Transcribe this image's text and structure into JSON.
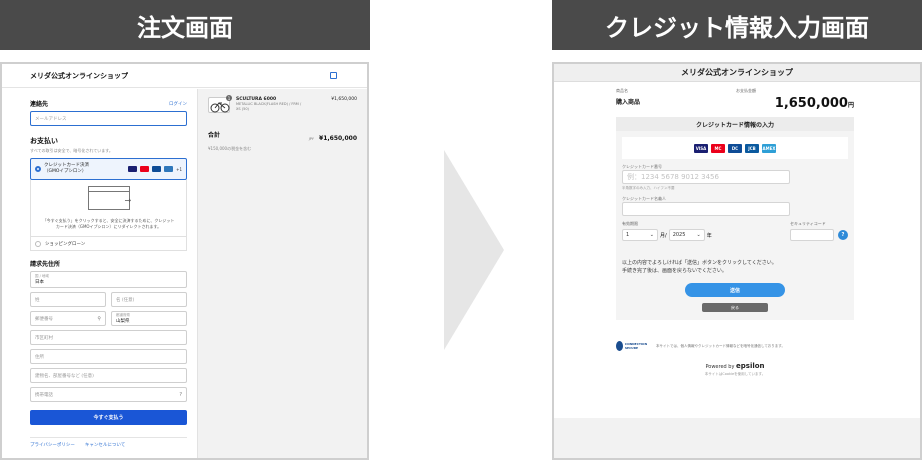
{
  "banners": {
    "left": "注文画面",
    "right": "クレジット情報入力画面"
  },
  "order": {
    "store_title": "メリダ公式オンラインショップ",
    "contact": {
      "heading": "連絡先",
      "login_link": "ログイン",
      "email_placeholder": "メールアドレス"
    },
    "payment": {
      "heading": "お支払い",
      "note": "すべての取引は安全で、暗号化されています。",
      "method_label": "クレジットカード決済（GMOイプシロン）",
      "more_cards": "+1",
      "redirect_text": "「今すぐ支払う」をクリックすると、安全に決済するために、クレジットカード決済（GMOイプシロン）にリダイレクトされます。",
      "loan_label": "ショッピングローン"
    },
    "shipping": {
      "heading": "請求先住所",
      "country_label": "国 / 地域",
      "country_value": "日本",
      "last_name": "姓",
      "first_name": "名 (任意)",
      "postal": "郵便番号",
      "prefecture_label": "都道府県",
      "prefecture_value": "山梨県",
      "city": "市区町村",
      "address": "住所",
      "building": "建物名、部屋番号など (任意)",
      "phone": "携帯電話"
    },
    "pay_button": "今すぐ支払う",
    "footer_links": [
      "プライバシーポリシー",
      "キャンセルについて"
    ],
    "summary": {
      "badge": "1",
      "product_name": "SCULTURA 6000",
      "product_detail": "METALLIC BLACK(FLASH RED) / FRM / XS (50)",
      "product_price": "¥1,650,000",
      "total_label": "合計",
      "total_currency": "JPY",
      "total_value": "¥1,650,000",
      "tax_note": "¥150,000の税金を含む"
    }
  },
  "credit": {
    "store_title": "メリダ公式オンラインショップ",
    "item_label": "商品名",
    "item_value": "購入商品",
    "amount_label": "お支払金額",
    "amount_value": "1,650,000",
    "amount_unit": "円",
    "section_title": "クレジットカード情報の入力",
    "brands": [
      "VISA",
      "MC",
      "DC",
      "JCB",
      "AMEX"
    ],
    "card_number_label": "クレジットカード番号",
    "card_number_placeholder": "例：1234 5678 9012 3456",
    "card_number_help": "半角数字のみ入力、ハイフン不要",
    "holder_label": "クレジットカード名義人",
    "expiry_label": "有効期限",
    "expiry_month": "1",
    "month_unit": "月/",
    "expiry_year": "2025",
    "year_unit": "年",
    "security_label": "セキュリティコード",
    "help_symbol": "?",
    "note_line1": "以上の内容でよろしければ「送信」ボタンをクリックしてください。",
    "note_line2": "手続き完了後は、画面を戻らないでください。",
    "send_button": "送信",
    "back_button": "戻る",
    "security_badge": "CONNECTION SECURE",
    "security_text": "本サイトでは、個人情報やクレジットカード情報などを暗号化通信しております。",
    "powered_by": "Powered by",
    "powered_brand": "epsilon",
    "footer_text": "本サイトはCookieを使用しています。"
  },
  "colors": {
    "banner": "#4a4a4a",
    "accent_blue": "#1a56d6",
    "send_blue": "#3593e6",
    "arrow": "#e6e6e6"
  }
}
